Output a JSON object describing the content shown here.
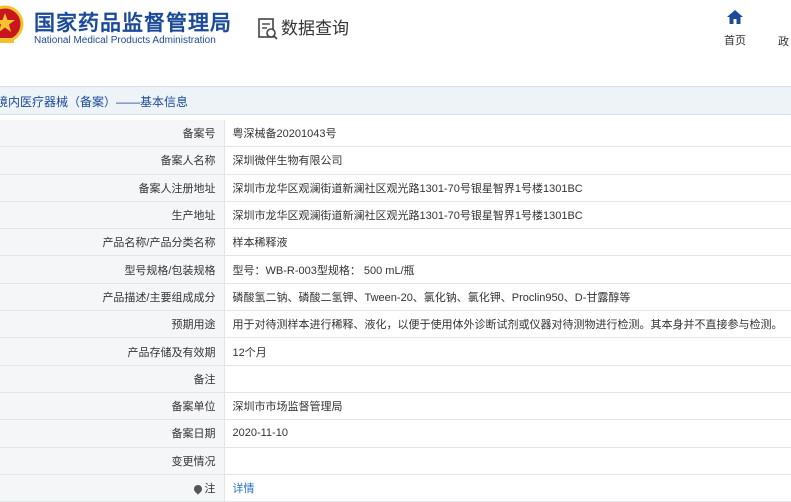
{
  "header": {
    "logo_cn": "国家药品监督管理局",
    "logo_en": "National Medical Products Administration",
    "query_title": "数据查询",
    "nav_home": "首页",
    "nav_more": "政"
  },
  "section_title": "境内医疗器械（备案）——基本信息",
  "rows": [
    {
      "label": "备案号",
      "value": "粤深械备20201043号"
    },
    {
      "label": "备案人名称",
      "value": "深圳微伴生物有限公司"
    },
    {
      "label": "备案人注册地址",
      "value": "深圳市龙华区观澜街道新澜社区观光路1301-70号银星智界1号楼1301BC"
    },
    {
      "label": "生产地址",
      "value": "深圳市龙华区观澜街道新澜社区观光路1301-70号银星智界1号楼1301BC"
    },
    {
      "label": "产品名称/产品分类名称",
      "value": "样本稀释液"
    },
    {
      "label": "型号规格/包装规格",
      "value": "型号：WB-R-003型规格： 500 mL/瓶"
    },
    {
      "label": "产品描述/主要组成成分",
      "value": "磷酸氢二钠、磷酸二氢钾、Tween-20、氯化钠、氯化钾、Proclin950、D-甘露醇等"
    },
    {
      "label": "预期用途",
      "value": "用于对待测样本进行稀释、液化，以便于使用体外诊断试剂或仪器对待测物进行检测。其本身并不直接参与检测。"
    },
    {
      "label": "产品存储及有效期",
      "value": "12个月"
    },
    {
      "label": "备注",
      "value": ""
    },
    {
      "label": "备案单位",
      "value": "深圳市市场监督管理局"
    },
    {
      "label": "备案日期",
      "value": "2020-11-10"
    },
    {
      "label": "变更情况",
      "value": ""
    }
  ],
  "note_row": {
    "label": "注",
    "link_text": "详情"
  },
  "colors": {
    "brand_blue": "#1b4a99",
    "link_blue": "#2a6fc9",
    "emblem_red": "#c8161d",
    "emblem_gold": "#f2c230"
  }
}
